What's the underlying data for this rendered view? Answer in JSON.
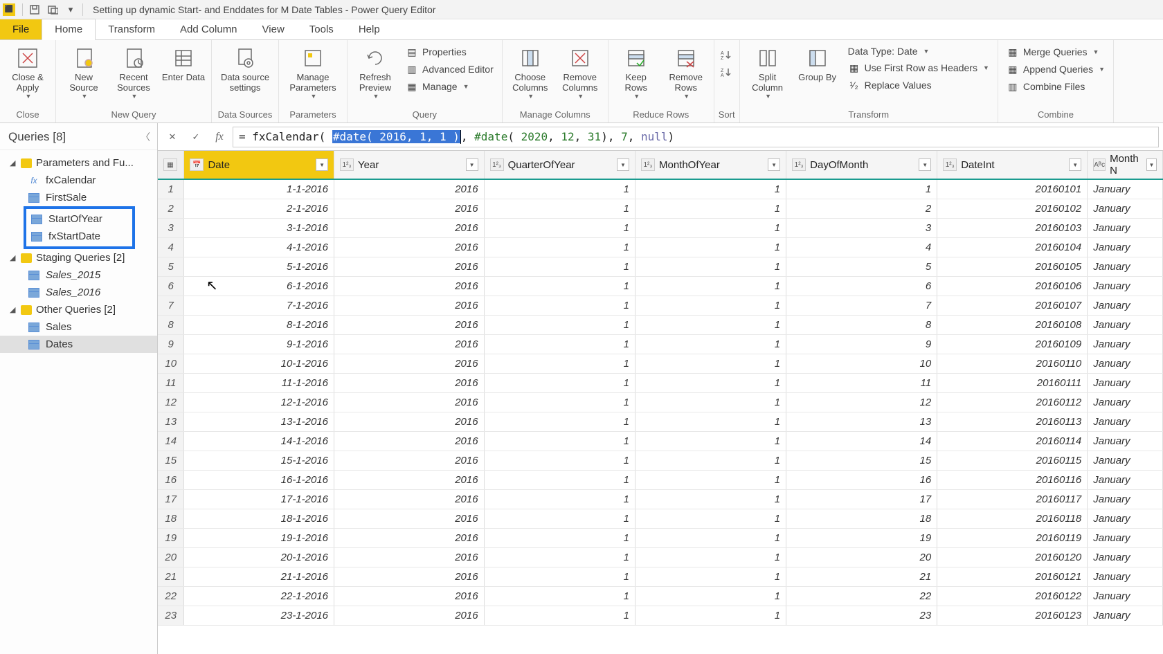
{
  "window": {
    "title": "Setting up dynamic Start- and Enddates for M Date Tables - Power Query Editor"
  },
  "menu": {
    "file": "File",
    "tabs": [
      "Home",
      "Transform",
      "Add Column",
      "View",
      "Tools",
      "Help"
    ],
    "active": "Home"
  },
  "ribbon": {
    "close": {
      "close_apply": "Close &\nApply",
      "group": "Close"
    },
    "newquery": {
      "new_source": "New\nSource",
      "recent_sources": "Recent\nSources",
      "enter_data": "Enter\nData",
      "group": "New Query"
    },
    "datasources": {
      "settings": "Data source\nsettings",
      "group": "Data Sources"
    },
    "parameters": {
      "manage": "Manage\nParameters",
      "group": "Parameters"
    },
    "query": {
      "refresh": "Refresh\nPreview",
      "properties": "Properties",
      "adv_editor": "Advanced Editor",
      "manage": "Manage",
      "group": "Query"
    },
    "manage_cols": {
      "choose": "Choose\nColumns",
      "remove": "Remove\nColumns",
      "group": "Manage Columns"
    },
    "reduce_rows": {
      "keep": "Keep\nRows",
      "remove": "Remove\nRows",
      "group": "Reduce Rows"
    },
    "sort": {
      "group": "Sort"
    },
    "transform": {
      "split": "Split\nColumn",
      "groupby": "Group\nBy",
      "datatype": "Data Type: Date",
      "firstrow": "Use First Row as Headers",
      "replace": "Replace Values",
      "group": "Transform"
    },
    "combine": {
      "merge": "Merge Queries",
      "append": "Append Queries",
      "combine_files": "Combine Files",
      "group": "Combine"
    }
  },
  "sidebar": {
    "header": "Queries [8]",
    "groups": [
      {
        "label": "Parameters and Fu...",
        "items": [
          {
            "name": "fxCalendar",
            "kind": "fx"
          },
          {
            "name": "FirstSale",
            "kind": "table"
          },
          {
            "name": "StartOfYear",
            "kind": "table",
            "hl": true
          },
          {
            "name": "fxStartDate",
            "kind": "table",
            "hl": true
          }
        ]
      },
      {
        "label": "Staging Queries [2]",
        "items": [
          {
            "name": "Sales_2015",
            "kind": "table",
            "italic": true
          },
          {
            "name": "Sales_2016",
            "kind": "table",
            "italic": true
          }
        ]
      },
      {
        "label": "Other Queries [2]",
        "items": [
          {
            "name": "Sales",
            "kind": "table"
          },
          {
            "name": "Dates",
            "kind": "table",
            "selected": true
          }
        ]
      }
    ]
  },
  "formula": {
    "prefix": "= fxCalendar( ",
    "sel": "#date( 2016, 1, 1 )",
    "mid1": ", ",
    "kw2": "#date",
    "paren": "( ",
    "n1": "2020",
    "c1": ", ",
    "n2": "12",
    "c2": ", ",
    "n3": "31",
    "close1": "), ",
    "n4": "7",
    "c3": ", ",
    "nullkw": "null",
    "close2": ")"
  },
  "columns": [
    {
      "name": "Date",
      "type": "cal",
      "selected": true
    },
    {
      "name": "Year",
      "type": "123"
    },
    {
      "name": "QuarterOfYear",
      "type": "123"
    },
    {
      "name": "MonthOfYear",
      "type": "123"
    },
    {
      "name": "DayOfMonth",
      "type": "123"
    },
    {
      "name": "DateInt",
      "type": "123"
    },
    {
      "name": "Month N",
      "type": "ABC",
      "partial": true
    }
  ],
  "rows": [
    {
      "n": 1,
      "Date": "1-1-2016",
      "Year": 2016,
      "QuarterOfYear": 1,
      "MonthOfYear": 1,
      "DayOfMonth": 1,
      "DateInt": 20160101,
      "MonthN": "January"
    },
    {
      "n": 2,
      "Date": "2-1-2016",
      "Year": 2016,
      "QuarterOfYear": 1,
      "MonthOfYear": 1,
      "DayOfMonth": 2,
      "DateInt": 20160102,
      "MonthN": "January"
    },
    {
      "n": 3,
      "Date": "3-1-2016",
      "Year": 2016,
      "QuarterOfYear": 1,
      "MonthOfYear": 1,
      "DayOfMonth": 3,
      "DateInt": 20160103,
      "MonthN": "January"
    },
    {
      "n": 4,
      "Date": "4-1-2016",
      "Year": 2016,
      "QuarterOfYear": 1,
      "MonthOfYear": 1,
      "DayOfMonth": 4,
      "DateInt": 20160104,
      "MonthN": "January"
    },
    {
      "n": 5,
      "Date": "5-1-2016",
      "Year": 2016,
      "QuarterOfYear": 1,
      "MonthOfYear": 1,
      "DayOfMonth": 5,
      "DateInt": 20160105,
      "MonthN": "January"
    },
    {
      "n": 6,
      "Date": "6-1-2016",
      "Year": 2016,
      "QuarterOfYear": 1,
      "MonthOfYear": 1,
      "DayOfMonth": 6,
      "DateInt": 20160106,
      "MonthN": "January"
    },
    {
      "n": 7,
      "Date": "7-1-2016",
      "Year": 2016,
      "QuarterOfYear": 1,
      "MonthOfYear": 1,
      "DayOfMonth": 7,
      "DateInt": 20160107,
      "MonthN": "January"
    },
    {
      "n": 8,
      "Date": "8-1-2016",
      "Year": 2016,
      "QuarterOfYear": 1,
      "MonthOfYear": 1,
      "DayOfMonth": 8,
      "DateInt": 20160108,
      "MonthN": "January"
    },
    {
      "n": 9,
      "Date": "9-1-2016",
      "Year": 2016,
      "QuarterOfYear": 1,
      "MonthOfYear": 1,
      "DayOfMonth": 9,
      "DateInt": 20160109,
      "MonthN": "January"
    },
    {
      "n": 10,
      "Date": "10-1-2016",
      "Year": 2016,
      "QuarterOfYear": 1,
      "MonthOfYear": 1,
      "DayOfMonth": 10,
      "DateInt": 20160110,
      "MonthN": "January"
    },
    {
      "n": 11,
      "Date": "11-1-2016",
      "Year": 2016,
      "QuarterOfYear": 1,
      "MonthOfYear": 1,
      "DayOfMonth": 11,
      "DateInt": 20160111,
      "MonthN": "January"
    },
    {
      "n": 12,
      "Date": "12-1-2016",
      "Year": 2016,
      "QuarterOfYear": 1,
      "MonthOfYear": 1,
      "DayOfMonth": 12,
      "DateInt": 20160112,
      "MonthN": "January"
    },
    {
      "n": 13,
      "Date": "13-1-2016",
      "Year": 2016,
      "QuarterOfYear": 1,
      "MonthOfYear": 1,
      "DayOfMonth": 13,
      "DateInt": 20160113,
      "MonthN": "January"
    },
    {
      "n": 14,
      "Date": "14-1-2016",
      "Year": 2016,
      "QuarterOfYear": 1,
      "MonthOfYear": 1,
      "DayOfMonth": 14,
      "DateInt": 20160114,
      "MonthN": "January"
    },
    {
      "n": 15,
      "Date": "15-1-2016",
      "Year": 2016,
      "QuarterOfYear": 1,
      "MonthOfYear": 1,
      "DayOfMonth": 15,
      "DateInt": 20160115,
      "MonthN": "January"
    },
    {
      "n": 16,
      "Date": "16-1-2016",
      "Year": 2016,
      "QuarterOfYear": 1,
      "MonthOfYear": 1,
      "DayOfMonth": 16,
      "DateInt": 20160116,
      "MonthN": "January"
    },
    {
      "n": 17,
      "Date": "17-1-2016",
      "Year": 2016,
      "QuarterOfYear": 1,
      "MonthOfYear": 1,
      "DayOfMonth": 17,
      "DateInt": 20160117,
      "MonthN": "January"
    },
    {
      "n": 18,
      "Date": "18-1-2016",
      "Year": 2016,
      "QuarterOfYear": 1,
      "MonthOfYear": 1,
      "DayOfMonth": 18,
      "DateInt": 20160118,
      "MonthN": "January"
    },
    {
      "n": 19,
      "Date": "19-1-2016",
      "Year": 2016,
      "QuarterOfYear": 1,
      "MonthOfYear": 1,
      "DayOfMonth": 19,
      "DateInt": 20160119,
      "MonthN": "January"
    },
    {
      "n": 20,
      "Date": "20-1-2016",
      "Year": 2016,
      "QuarterOfYear": 1,
      "MonthOfYear": 1,
      "DayOfMonth": 20,
      "DateInt": 20160120,
      "MonthN": "January"
    },
    {
      "n": 21,
      "Date": "21-1-2016",
      "Year": 2016,
      "QuarterOfYear": 1,
      "MonthOfYear": 1,
      "DayOfMonth": 21,
      "DateInt": 20160121,
      "MonthN": "January"
    },
    {
      "n": 22,
      "Date": "22-1-2016",
      "Year": 2016,
      "QuarterOfYear": 1,
      "MonthOfYear": 1,
      "DayOfMonth": 22,
      "DateInt": 20160122,
      "MonthN": "January"
    },
    {
      "n": 23,
      "Date": "23-1-2016",
      "Year": 2016,
      "QuarterOfYear": 1,
      "MonthOfYear": 1,
      "DayOfMonth": 23,
      "DateInt": 20160123,
      "MonthN": "January"
    }
  ]
}
